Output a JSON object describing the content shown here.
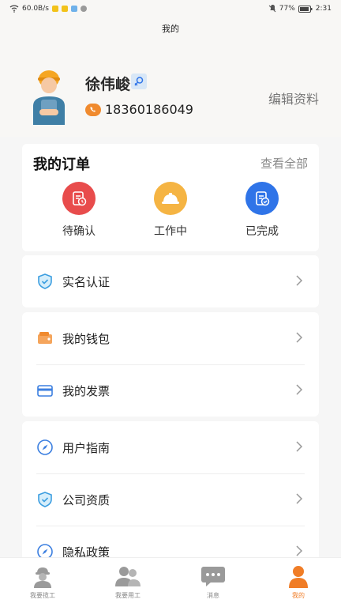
{
  "status_bar": {
    "left": "60.0B/s",
    "battery": "77%",
    "time": "2:31"
  },
  "header": {
    "title": "我的"
  },
  "profile": {
    "name": "徐伟峻",
    "phone": "18360186049",
    "edit_label": "编辑资料"
  },
  "orders": {
    "title": "我的订单",
    "view_all": "查看全部",
    "items": [
      {
        "label": "待确认",
        "icon": "clock-document-icon",
        "color": "#e84c4c"
      },
      {
        "label": "工作中",
        "icon": "hardhat-icon",
        "color": "#f5b443"
      },
      {
        "label": "已完成",
        "icon": "document-check-icon",
        "color": "#2f74e8"
      }
    ]
  },
  "menu": {
    "verification": {
      "label": "实名认证"
    },
    "wallet": {
      "label": "我的钱包"
    },
    "invoice": {
      "label": "我的发票"
    },
    "guide": {
      "label": "用户指南"
    },
    "qualification": {
      "label": "公司资质"
    },
    "privacy": {
      "label": "隐私政策"
    }
  },
  "tabbar": {
    "items": [
      {
        "label": "我要揽工"
      },
      {
        "label": "我要用工"
      },
      {
        "label": "消息"
      },
      {
        "label": "我的"
      }
    ],
    "active_color": "#f07d27"
  }
}
